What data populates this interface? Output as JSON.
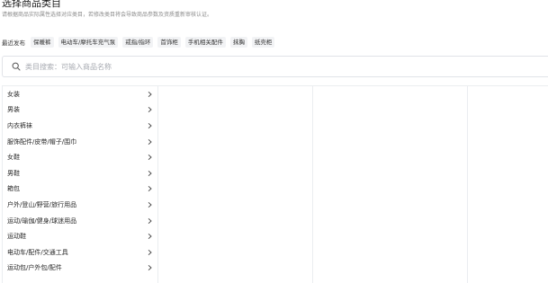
{
  "header": {
    "title": "选择商品类目",
    "subtitle": "请根据商品实际属性选择对应类目，若修改类目将会导致商品参数及资质重新审核认证。"
  },
  "recent": {
    "label": "最近发布",
    "chips": [
      "保暖裤",
      "电动车/摩托车充气泵",
      "戒指/指环",
      "首饰柜",
      "手机相关配件",
      "抹胸",
      "纸壳柜"
    ]
  },
  "search": {
    "placeholder": "类目搜索：可输入商品名称",
    "icon": "search-icon"
  },
  "categories": [
    "女装",
    "男装",
    "内衣裤袜",
    "服饰配件/皮带/帽子/围巾",
    "女鞋",
    "男鞋",
    "箱包",
    "户外/登山/野营/旅行用品",
    "运动/瑜伽/健身/球迷用品",
    "运动鞋",
    "电动车/配件/交通工具",
    "运动包/户外包/配件"
  ],
  "colors": {
    "border": "#ebedf0",
    "chip_bg": "#f2f3f5",
    "placeholder": "#a8abb2"
  }
}
